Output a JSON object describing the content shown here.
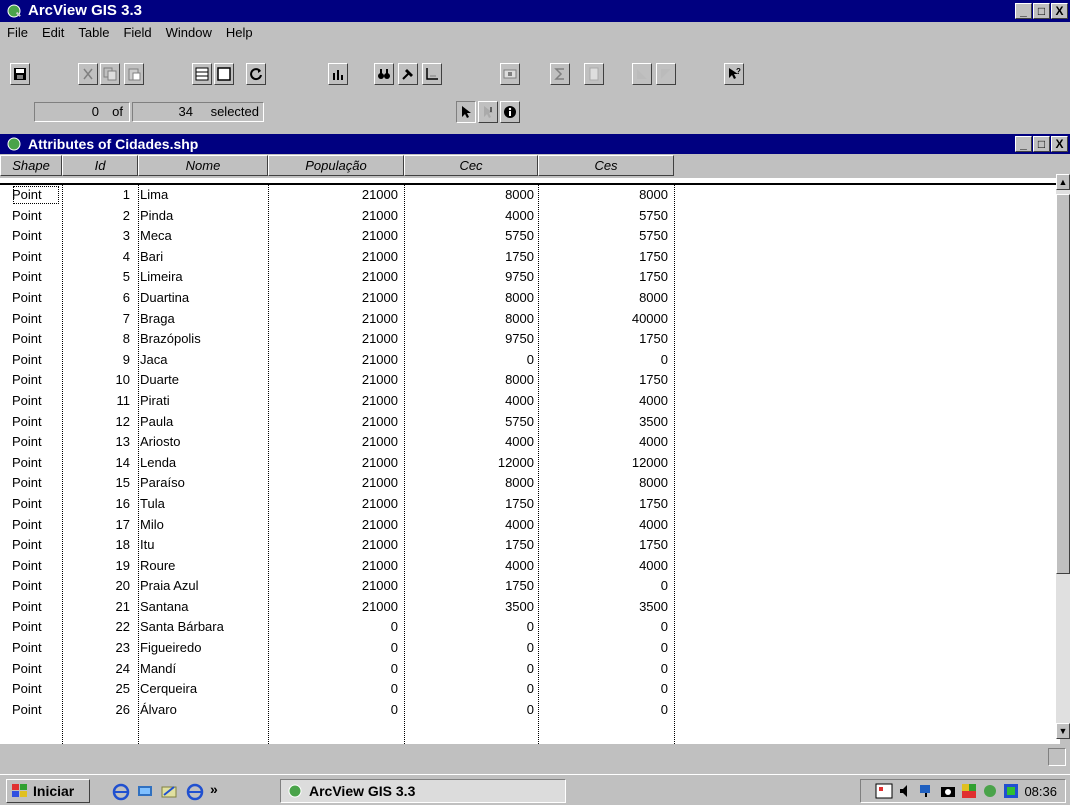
{
  "app": {
    "title": "ArcView GIS 3.3",
    "window_buttons": [
      "_",
      "□",
      "X"
    ]
  },
  "menu": [
    "File",
    "Edit",
    "Table",
    "Field",
    "Window",
    "Help"
  ],
  "selection": {
    "count": "0",
    "of_label": "of",
    "total": "34",
    "selected_label": "selected"
  },
  "child_window": {
    "title": "Attributes of Cidades.shp"
  },
  "table": {
    "columns": [
      "Shape",
      "Id",
      "Nome",
      "População",
      "Cec",
      "Ces"
    ],
    "rows": [
      [
        "Point",
        "1",
        "Lima",
        "21000",
        "8000",
        "8000"
      ],
      [
        "Point",
        "2",
        "Pinda",
        "21000",
        "4000",
        "5750"
      ],
      [
        "Point",
        "3",
        "Meca",
        "21000",
        "5750",
        "5750"
      ],
      [
        "Point",
        "4",
        "Bari",
        "21000",
        "1750",
        "1750"
      ],
      [
        "Point",
        "5",
        "Limeira",
        "21000",
        "9750",
        "1750"
      ],
      [
        "Point",
        "6",
        "Duartina",
        "21000",
        "8000",
        "8000"
      ],
      [
        "Point",
        "7",
        "Braga",
        "21000",
        "8000",
        "40000"
      ],
      [
        "Point",
        "8",
        "Brazópolis",
        "21000",
        "9750",
        "1750"
      ],
      [
        "Point",
        "9",
        "Jaca",
        "21000",
        "0",
        "0"
      ],
      [
        "Point",
        "10",
        "Duarte",
        "21000",
        "8000",
        "1750"
      ],
      [
        "Point",
        "11",
        "Pirati",
        "21000",
        "4000",
        "4000"
      ],
      [
        "Point",
        "12",
        "Paula",
        "21000",
        "5750",
        "3500"
      ],
      [
        "Point",
        "13",
        "Ariosto",
        "21000",
        "4000",
        "4000"
      ],
      [
        "Point",
        "14",
        "Lenda",
        "21000",
        "12000",
        "12000"
      ],
      [
        "Point",
        "15",
        "Paraíso",
        "21000",
        "8000",
        "8000"
      ],
      [
        "Point",
        "16",
        "Tula",
        "21000",
        "1750",
        "1750"
      ],
      [
        "Point",
        "17",
        "Milo",
        "21000",
        "4000",
        "4000"
      ],
      [
        "Point",
        "18",
        "Itu",
        "21000",
        "1750",
        "1750"
      ],
      [
        "Point",
        "19",
        "Roure",
        "21000",
        "4000",
        "4000"
      ],
      [
        "Point",
        "20",
        "Praia Azul",
        "21000",
        "1750",
        "0"
      ],
      [
        "Point",
        "21",
        "Santana",
        "21000",
        "3500",
        "3500"
      ],
      [
        "Point",
        "22",
        "Santa Bárbara",
        "0",
        "0",
        "0"
      ],
      [
        "Point",
        "23",
        "Figueiredo",
        "0",
        "0",
        "0"
      ],
      [
        "Point",
        "24",
        "Mandí",
        "0",
        "0",
        "0"
      ],
      [
        "Point",
        "25",
        "Cerqueira",
        "0",
        "0",
        "0"
      ],
      [
        "Point",
        "26",
        "Álvaro",
        "0",
        "0",
        "0"
      ]
    ]
  },
  "taskbar": {
    "start_label": "Iniciar",
    "chevron": "»",
    "task_label": "ArcView GIS 3.3",
    "clock": "08:36"
  },
  "colors": {
    "titlebar": "#000080",
    "face": "#c0c0c0",
    "table_bg": "#ffffff"
  }
}
